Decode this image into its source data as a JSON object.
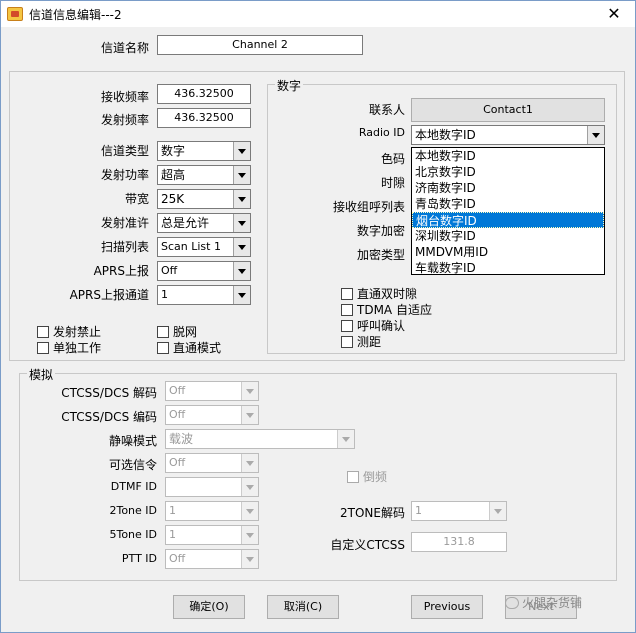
{
  "window": {
    "title": "信道信息编辑---2"
  },
  "channel_name": {
    "label": "信道名称",
    "value": "Channel 2"
  },
  "left": {
    "rx_freq": {
      "label": "接收频率",
      "value": "436.32500"
    },
    "tx_freq": {
      "label": "发射频率",
      "value": "436.32500"
    },
    "channel_type": {
      "label": "信道类型",
      "value": "数字"
    },
    "tx_power": {
      "label": "发射功率",
      "value": "超高"
    },
    "bandwidth": {
      "label": "带宽",
      "value": "25K"
    },
    "tx_permit": {
      "label": "发射准许",
      "value": "总是允许"
    },
    "scan_list": {
      "label": "扫描列表",
      "value": "Scan List 1"
    },
    "aprs_report": {
      "label": "APRS上报",
      "value": "Off"
    },
    "aprs_channel": {
      "label": "APRS上报通道",
      "value": "1"
    },
    "checks": {
      "tx_forbid": "发射禁止",
      "talkaround": "单独工作",
      "offnet": "脱网",
      "direct": "直通模式"
    }
  },
  "digital": {
    "group_label": "数字",
    "contact": {
      "label": "联系人",
      "value": "Contact1"
    },
    "radio_id": {
      "label": "Radio ID",
      "value": "本地数字ID"
    },
    "color_code": {
      "label": "色码"
    },
    "timeslot": {
      "label": "时隙"
    },
    "rx_group": {
      "label": "接收组呼列表"
    },
    "encrypt": {
      "label": "数字加密"
    },
    "encrypt_type": {
      "label": "加密类型"
    },
    "dropdown": [
      "本地数字ID",
      "北京数字ID",
      "济南数字ID",
      "青岛数字ID",
      "烟台数字ID",
      "深圳数字ID",
      "MMDVM用ID",
      "车载数字ID"
    ],
    "checks": {
      "dual_slot": "直通双时隙",
      "tdma": "TDMA 自适应",
      "call_confirm": "呼叫确认",
      "ranging": "测距"
    }
  },
  "analog": {
    "group_label": "模拟",
    "ctcss_decode": {
      "label": "CTCSS/DCS 解码",
      "value": "Off"
    },
    "ctcss_encode": {
      "label": "CTCSS/DCS 编码",
      "value": "Off"
    },
    "squelch": {
      "label": "静噪模式",
      "value": "载波"
    },
    "opt_signal": {
      "label": "可选信令",
      "value": "Off"
    },
    "dtmf_id": {
      "label": "DTMF ID",
      "value": ""
    },
    "tone2_id": {
      "label": "2Tone ID",
      "value": "1"
    },
    "tone5_id": {
      "label": "5Tone ID",
      "value": "1"
    },
    "ptt_id": {
      "label": "PTT ID",
      "value": "Off"
    },
    "reverse": "倒频",
    "tone2_decode": {
      "label": "2TONE解码",
      "value": "1"
    },
    "custom_ctcss": {
      "label": "自定义CTCSS",
      "value": "131.8"
    }
  },
  "buttons": {
    "ok": "确定(O)",
    "cancel": "取消(C)",
    "previous": "Previous",
    "next": "Next"
  },
  "watermark": "火腿杂货铺"
}
